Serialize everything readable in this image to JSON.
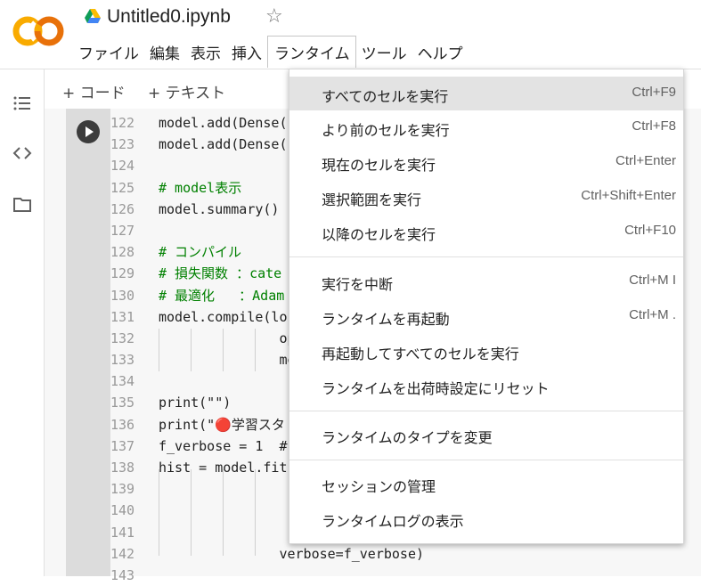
{
  "header": {
    "title": "Untitled0.ipynb",
    "logo_text": "CO",
    "star_glyph": "☆"
  },
  "menubar": [
    {
      "label": "ファイル"
    },
    {
      "label": "編集"
    },
    {
      "label": "表示"
    },
    {
      "label": "挿入"
    },
    {
      "label": "ランタイム"
    },
    {
      "label": "ツール"
    },
    {
      "label": "ヘルプ"
    }
  ],
  "toolbar": {
    "add_code": "+ コード",
    "add_text": "+ テキスト"
  },
  "left_rail": {
    "icons": [
      "toc-icon",
      "code-icon",
      "folder-icon"
    ]
  },
  "code": {
    "line_numbers": [
      "122",
      "123",
      "124",
      "125",
      "126",
      "127",
      "128",
      "129",
      "130",
      "131",
      "132",
      "133",
      "134",
      "135",
      "136",
      "137",
      "138",
      "139",
      "140",
      "141",
      "142",
      "143"
    ],
    "lines": [
      "model.add(Dense(",
      "model.add(Dense(",
      "",
      "# model表示",
      "model.summary()",
      "",
      "# コンパイル",
      "# 損失関数 ：cate",
      "# 最適化   ：Adam",
      "model.compile(los",
      "               opt",
      "               met",
      "",
      "print(\"\")",
      "print(\"🔴学習スタ",
      "f_verbose = 1  #",
      "hist = model.fit",
      "",
      "",
      "",
      "               verbose=f_verbose)",
      ""
    ]
  },
  "dropdown": {
    "items": [
      {
        "label": "すべてのセルを実行",
        "shortcut": "Ctrl+F9"
      },
      {
        "label": "より前のセルを実行",
        "shortcut": "Ctrl+F8"
      },
      {
        "label": "現在のセルを実行",
        "shortcut": "Ctrl+Enter"
      },
      {
        "label": "選択範囲を実行",
        "shortcut": "Ctrl+Shift+Enter"
      },
      {
        "label": "以降のセルを実行",
        "shortcut": "Ctrl+F10"
      },
      {
        "label": "実行を中断",
        "shortcut": "Ctrl+M I"
      },
      {
        "label": "ランタイムを再起動",
        "shortcut": "Ctrl+M ."
      },
      {
        "label": "再起動してすべてのセルを実行",
        "shortcut": ""
      },
      {
        "label": "ランタイムを出荷時設定にリセット",
        "shortcut": ""
      },
      {
        "label": "ランタイムのタイプを変更",
        "shortcut": ""
      },
      {
        "label": "セッションの管理",
        "shortcut": ""
      },
      {
        "label": "ランタイムログの表示",
        "shortcut": ""
      }
    ]
  },
  "colors": {
    "logo_orange": "#f9ab00",
    "logo_dark_orange": "#e8710a",
    "menu_highlight": "#e3e3e3",
    "comment": "#008000",
    "record_dot": "#c62828"
  }
}
